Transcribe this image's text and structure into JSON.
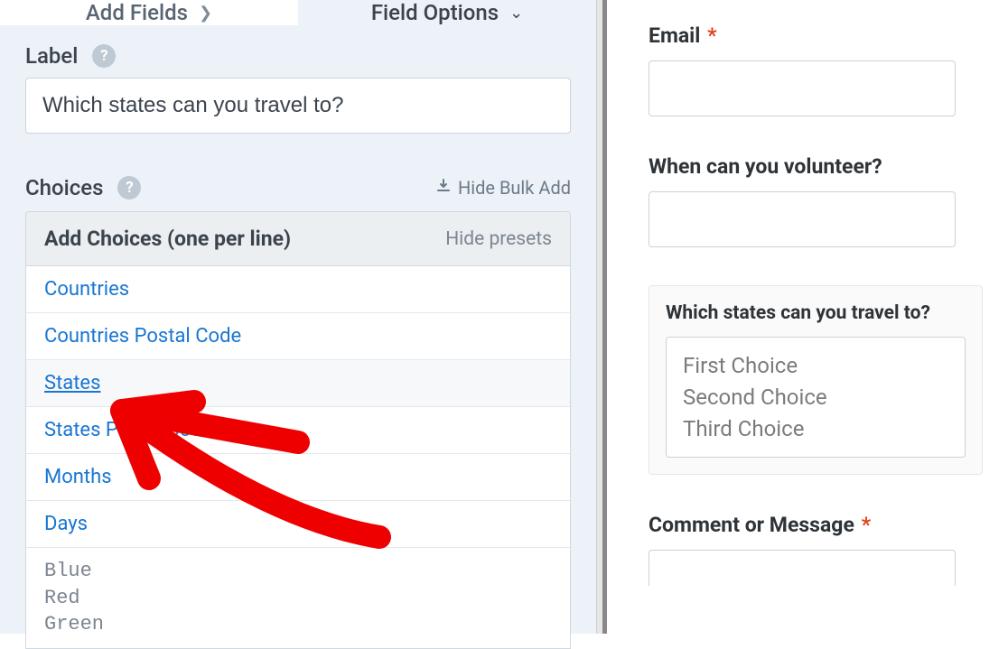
{
  "tabs": {
    "add_fields": "Add Fields",
    "field_options": "Field Options"
  },
  "label_section": {
    "title": "Label",
    "value": "Which states can you travel to?"
  },
  "choices_section": {
    "title": "Choices",
    "hide_bulk": "Hide Bulk Add",
    "add_choices_title": "Add Choices (one per line)",
    "hide_presets": "Hide presets",
    "presets": [
      "Countries",
      "Countries Postal Code",
      "States",
      "States Postal Code",
      "Months",
      "Days"
    ],
    "textarea_lines": [
      "Blue",
      "Red",
      "Green"
    ]
  },
  "form_preview": {
    "email": {
      "label": "Email",
      "required": true
    },
    "volunteer": {
      "label": "When can you volunteer?"
    },
    "states_field": {
      "label": "Which states can you travel to?",
      "options": [
        "First Choice",
        "Second Choice",
        "Third Choice"
      ]
    },
    "comment": {
      "label": "Comment or Message",
      "required": true
    }
  }
}
